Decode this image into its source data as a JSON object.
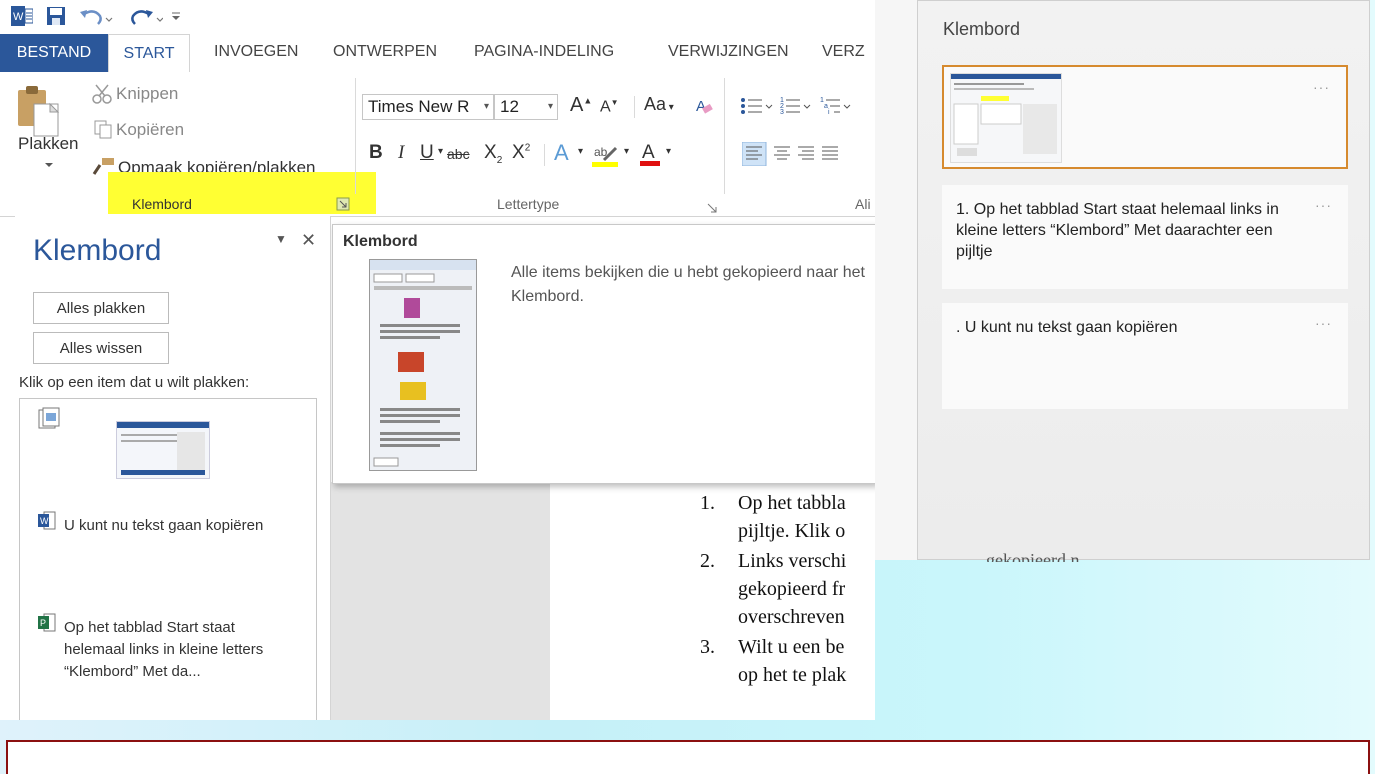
{
  "word": {
    "tabs": [
      "BESTAND",
      "START",
      "INVOEGEN",
      "ONTWERPEN",
      "PAGINA-INDELING",
      "VERWIJZINGEN",
      "VERZ"
    ],
    "clipboard": {
      "paste": "Plakken",
      "cut": "Knippen",
      "copy": "Kopiëren",
      "format_painter": "Opmaak kopiëren/plakken",
      "group_label": "Klembord"
    },
    "font": {
      "name": "Times New R",
      "size": "12",
      "group_label": "Lettertype",
      "aa": "Aa"
    },
    "paragraph_group_label": "Ali",
    "highlight_color": "#ffff33"
  },
  "pane": {
    "title": "Klembord",
    "paste_all": "Alles plakken",
    "clear_all": "Alles wissen",
    "instruction": "Klik op een item dat u wilt plakken:",
    "items": [
      {
        "text": "U kunt nu tekst gaan kopiëren",
        "icon": "word-icon"
      },
      {
        "text": "Op het tabblad Start staat helemaal links in kleine letters “Klembord” Met da...",
        "icon": "publisher-icon"
      }
    ]
  },
  "tooltip": {
    "title": "Klembord",
    "description": "Alle items bekijken die u hebt gekopieerd naar het Klembord."
  },
  "document": {
    "lines": [
      {
        "num": "1.",
        "text": "Op het tabbla"
      },
      {
        "num": "",
        "text": "pijltje. Klik o"
      },
      {
        "num": "2.",
        "text": "Links verschi"
      },
      {
        "num": "",
        "text": "gekopieerd fr"
      },
      {
        "num": "",
        "text": "overschreven"
      },
      {
        "num": "3.",
        "text": "Wilt u een be"
      },
      {
        "num": "",
        "text": "op het te plak"
      }
    ]
  },
  "windows_clipboard": {
    "title": "Klembord",
    "items": [
      {
        "type": "image"
      },
      {
        "text": "1. Op het tabblad Start staat helemaal links in kleine letters “Klembord” Met daarachter een pijltje"
      },
      {
        "text": ". U kunt nu tekst gaan kopiëren"
      }
    ],
    "more": "···",
    "underlying_text": "gekopieerd n",
    "selected_border_color": "#d68a2e"
  }
}
